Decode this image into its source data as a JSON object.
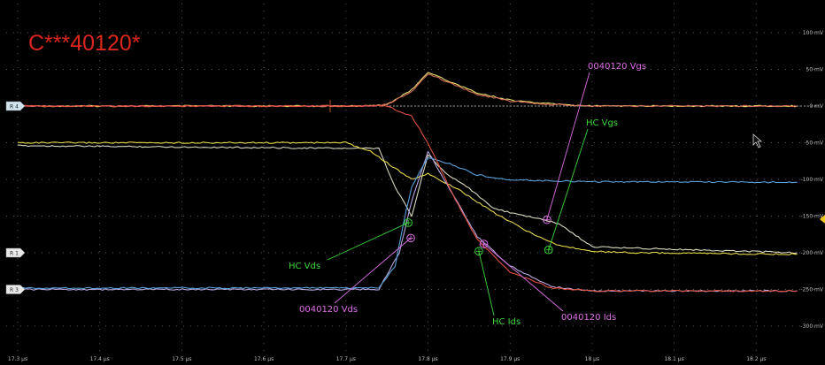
{
  "chart_data": {
    "type": "line",
    "title": "C***40120*",
    "title_color": "#d9261c",
    "background": "#000000",
    "grid": true,
    "x_unit": "µs",
    "xlim": [
      17.3,
      18.25
    ],
    "x_ticks": [
      "17.3 µs",
      "17.4 µs",
      "17.5 µs",
      "17.6 µs",
      "17.7 µs",
      "17.8 µs",
      "17.9 µs",
      "18 µs",
      "18.1 µs",
      "18.2 µs"
    ],
    "ylim": [
      -340,
      115
    ],
    "y_ticks": [
      "100 mV",
      "50 mV",
      "0 mV",
      "-50 mV",
      "-100 mV",
      "-150 mV",
      "-200 mV",
      "-250 mV",
      "-300 mV"
    ],
    "channel_markers": [
      "R 4",
      "R 1",
      "R 3"
    ],
    "series": [
      {
        "color": "#e8e06a",
        "x": [
          17.3,
          17.6,
          17.72,
          17.75,
          17.78,
          17.8,
          17.83,
          17.86,
          17.9,
          17.95,
          18.0,
          18.25
        ],
        "values": [
          0,
          0,
          0,
          2,
          22,
          46,
          32,
          18,
          8,
          3,
          0,
          0
        ]
      },
      {
        "color": "#d46a5a",
        "x": [
          17.3,
          17.72,
          17.75,
          17.78,
          17.8,
          17.83,
          17.86,
          17.9,
          17.95,
          18.0,
          18.25
        ],
        "values": [
          0,
          0,
          2,
          20,
          44,
          30,
          16,
          7,
          2,
          0,
          0
        ]
      },
      {
        "color": "#d8d8c0",
        "x": [
          17.3,
          17.74,
          17.76,
          17.78,
          17.8,
          17.82,
          17.85,
          17.88,
          17.92,
          17.96,
          18.0,
          18.25
        ],
        "values": [
          -54,
          -58,
          -110,
          -150,
          -66,
          -90,
          -112,
          -140,
          -150,
          -160,
          -192,
          -200
        ]
      },
      {
        "color": "#e6d84a",
        "x": [
          17.3,
          17.7,
          17.73,
          17.76,
          17.78,
          17.8,
          17.84,
          17.88,
          17.92,
          17.96,
          18.0,
          18.05,
          18.25
        ],
        "values": [
          -50,
          -50,
          -62,
          -85,
          -100,
          -92,
          -116,
          -145,
          -170,
          -190,
          -198,
          -200,
          -202
        ]
      },
      {
        "color": "#b8a8e0",
        "x": [
          17.3,
          17.74,
          17.765,
          17.78,
          17.8,
          17.83,
          17.86,
          17.9,
          17.95,
          18.0,
          18.25
        ],
        "values": [
          -250,
          -250,
          -200,
          -130,
          -62,
          -120,
          -178,
          -218,
          -246,
          -252,
          -252
        ]
      },
      {
        "color": "#5a9fd8",
        "x": [
          17.3,
          17.74,
          17.76,
          17.77,
          17.78,
          17.8,
          17.83,
          17.86,
          17.9,
          17.95,
          18.0,
          18.25
        ],
        "values": [
          -248,
          -248,
          -218,
          -160,
          -110,
          -70,
          -80,
          -94,
          -100,
          -102,
          -103,
          -104
        ]
      },
      {
        "color": "#e05040",
        "x": [
          17.3,
          17.75,
          17.78,
          17.8,
          17.83,
          17.86,
          17.9,
          17.95,
          18.0,
          18.25
        ],
        "values": [
          0,
          0,
          -14,
          -50,
          -120,
          -182,
          -226,
          -248,
          -252,
          -252
        ]
      }
    ],
    "annotations": [
      {
        "text": "0040120 Vgs",
        "color": "#e070e8",
        "marker_x": 17.945,
        "marker_y": -155
      },
      {
        "text": "HC Vgs",
        "color": "#3ad63a",
        "marker_x": 17.947,
        "marker_y": -196
      },
      {
        "text": "HC Vds",
        "color": "#3ad63a",
        "marker_x": 17.776,
        "marker_y": -159
      },
      {
        "text": "0040120 Vds",
        "color": "#e070e8",
        "marker_x": 17.779,
        "marker_y": -180
      },
      {
        "text": "HC Ids",
        "color": "#3ad63a",
        "marker_x": 17.862,
        "marker_y": -198
      },
      {
        "text": "0040120 Ids",
        "color": "#e070e8",
        "marker_x": 17.868,
        "marker_y": -188
      }
    ]
  }
}
